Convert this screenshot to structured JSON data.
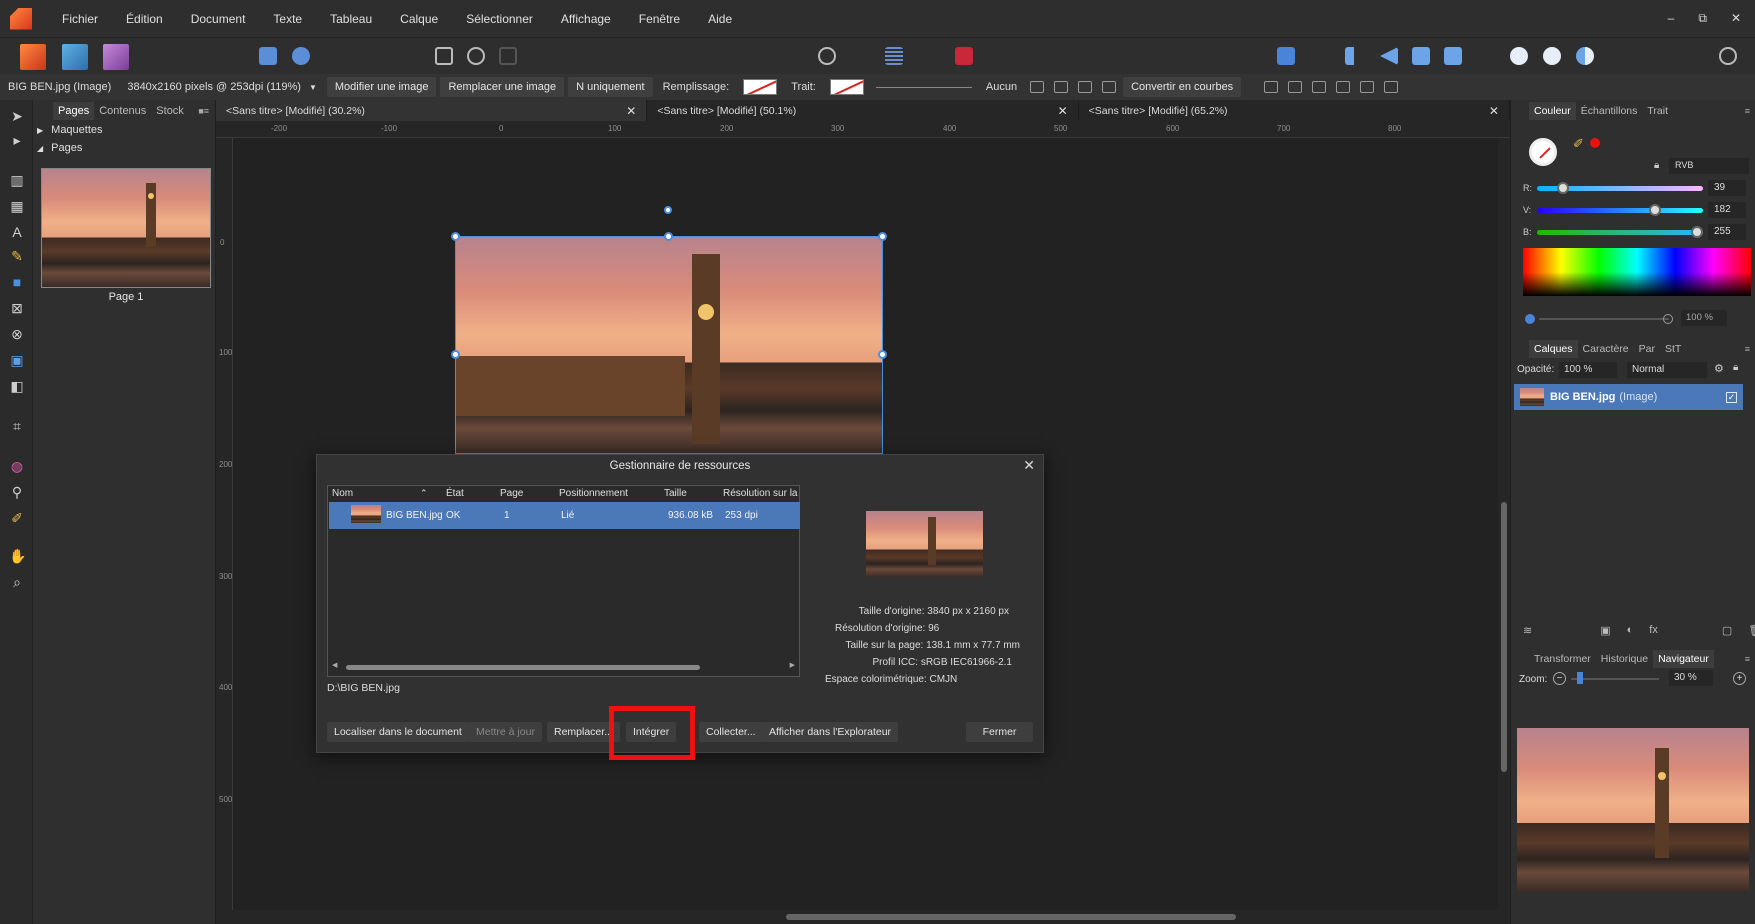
{
  "menu": [
    "Fichier",
    "Édition",
    "Document",
    "Texte",
    "Tableau",
    "Calque",
    "Sélectionner",
    "Affichage",
    "Fenêtre",
    "Aide"
  ],
  "window_controls": [
    "–",
    "⧉",
    "✕"
  ],
  "context": {
    "selection": "BIG BEN.jpg (Image)",
    "dimensions": "3840x2160 pixels @ 253dpi (119%)",
    "modify_image": "Modifier une image",
    "replace_image": "Remplacer une image",
    "n_only": "N uniquement",
    "fill_label": "Remplissage:",
    "stroke_label": "Trait:",
    "stroke_none": "Aucun",
    "convert_curves": "Convertir en courbes"
  },
  "pages_panel": {
    "tabs": [
      "Pages",
      "Contenus",
      "Stock"
    ],
    "masters": "Maquettes",
    "pages": "Pages",
    "page_label": "Page 1"
  },
  "doc_tabs": [
    {
      "title": "<Sans titre> [Modifié] (30.2%)"
    },
    {
      "title": "<Sans titre> [Modifié] (50.1%)"
    },
    {
      "title": "<Sans titre> [Modifié] (65.2%)"
    }
  ],
  "ruler": {
    "h": [
      "-200",
      "-100",
      "0",
      "100",
      "200",
      "300",
      "400",
      "500",
      "600",
      "700",
      "800"
    ],
    "v": [
      "0",
      "100",
      "200",
      "300",
      "400",
      "500"
    ]
  },
  "dialog": {
    "title": "Gestionnaire de ressources",
    "columns": [
      "Nom",
      "État",
      "Page",
      "Positionnement",
      "Taille",
      "Résolution sur la"
    ],
    "row": {
      "name": "BIG BEN.jpg",
      "state": "OK",
      "page": "1",
      "placement": "Lié",
      "size": "936.08 kB",
      "resolution": "253 dpi"
    },
    "path": "D:\\BIG BEN.jpg",
    "info": [
      "Taille d'origine: 3840 px x 2160 px",
      "Résolution d'origine: 96",
      "Taille sur la page: 138.1 mm x 77.7 mm",
      "Profil ICC: sRGB IEC61966-2.1",
      "Espace colorimétrique: CMJN"
    ],
    "buttons": {
      "locate": "Localiser dans le document",
      "update": "Mettre à jour",
      "replace": "Remplacer...",
      "embed": "Intégrer",
      "collect": "Collecter...",
      "explorer": "Afficher dans l'Explorateur",
      "close": "Fermer"
    }
  },
  "color_panel": {
    "tabs": [
      "Couleur",
      "Échantillons",
      "Trait"
    ],
    "mode": "RVB",
    "r_label": "R:",
    "r": "39",
    "g_label": "V:",
    "g": "182",
    "b_label": "B:",
    "b": "255",
    "opacity_value": "100 %",
    "accent": "#27b6ff"
  },
  "layers_panel": {
    "tabs": [
      "Calques",
      "Caractère",
      "Par",
      "StT"
    ],
    "opacity_label": "Opacité:",
    "opacity": "100 %",
    "blend": "Normal",
    "layer_name": "BIG BEN.jpg",
    "layer_type": "(Image)"
  },
  "nav_panel": {
    "tabs": [
      "Transformer",
      "Historique",
      "Navigateur"
    ],
    "zoom_label": "Zoom:",
    "zoom": "30 %"
  },
  "colors": {
    "selection": "#4a78b8",
    "highlight": "#e11111"
  }
}
